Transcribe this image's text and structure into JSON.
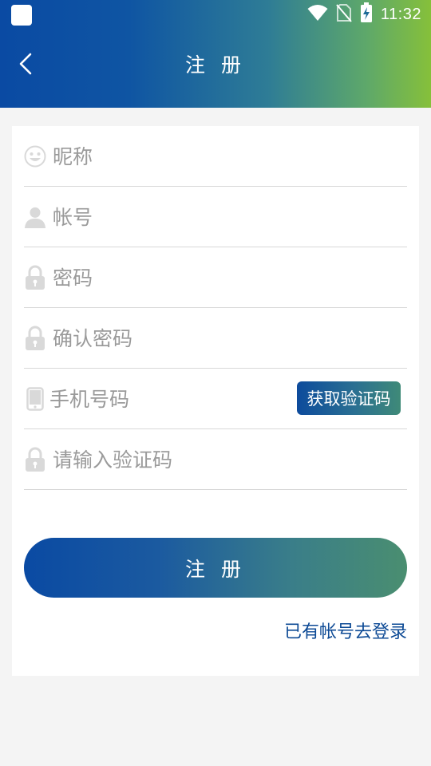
{
  "status_bar": {
    "time": "11:32",
    "icons": [
      "wifi-icon",
      "no-sim-icon",
      "battery-charging-icon"
    ]
  },
  "header": {
    "title": "注 册",
    "back_icon": "chevron-left-icon"
  },
  "form": {
    "nickname": {
      "placeholder": "昵称",
      "icon": "face-icon"
    },
    "account": {
      "placeholder": "帐号",
      "icon": "user-icon"
    },
    "password": {
      "placeholder": "密码",
      "icon": "lock-icon"
    },
    "confirm_password": {
      "placeholder": "确认密码",
      "icon": "lock-icon"
    },
    "phone": {
      "placeholder": "手机号码",
      "icon": "phone-icon"
    },
    "get_code_label": "获取验证码",
    "code": {
      "placeholder": "请输入验证码",
      "icon": "lock-icon"
    }
  },
  "actions": {
    "register_label": "注 册",
    "login_link": "已有帐号去登录"
  },
  "colors": {
    "header_start": "#0a4aa3",
    "header_end": "#86c03a",
    "link": "#0d4a95",
    "placeholder": "#9a9a9a",
    "icon": "#d9d9d9"
  }
}
